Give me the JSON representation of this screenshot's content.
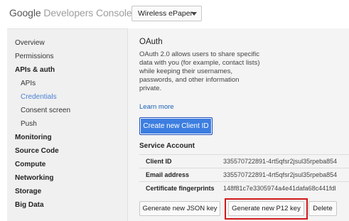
{
  "app": {
    "brand_google": "Google",
    "brand_console": "Developers Console"
  },
  "project_select": {
    "value": "Wireless ePaper"
  },
  "sidebar": {
    "items": [
      {
        "label": "Overview"
      },
      {
        "label": "Permissions"
      },
      {
        "label": "APIs & auth"
      },
      {
        "label": "APIs"
      },
      {
        "label": "Credentials"
      },
      {
        "label": "Consent screen"
      },
      {
        "label": "Push"
      },
      {
        "label": "Monitoring"
      },
      {
        "label": "Source Code"
      },
      {
        "label": "Compute"
      },
      {
        "label": "Networking"
      },
      {
        "label": "Storage"
      },
      {
        "label": "Big Data"
      }
    ],
    "active_item": "Credentials"
  },
  "oauth": {
    "title": "OAuth",
    "description": "OAuth 2.0 allows users to share specific data with you (for example, contact lists) while keeping their usernames, passwords, and other information private.",
    "learn_more": "Learn more",
    "create_button": "Create new Client ID"
  },
  "service_account": {
    "title": "Service Account",
    "rows": [
      {
        "label": "Client ID",
        "value": "335570722891-4rt5qfsr2jsul35rpeba854"
      },
      {
        "label": "Email address",
        "value": "335570722891-4rt5qfsr2jsul35rpeba854"
      },
      {
        "label": "Certificate fingerprints",
        "value": "148f81c7e3305974a4e41dafa68c441fdl"
      }
    ],
    "buttons": {
      "json_key": "Generate new JSON key",
      "p12_key": "Generate new P12 key",
      "delete": "Delete"
    }
  },
  "colors": {
    "primary_button": "#3c7ee0",
    "active_nav": "#4a7fd6",
    "link": "#1a5fb4",
    "highlight": "#d0191b"
  }
}
